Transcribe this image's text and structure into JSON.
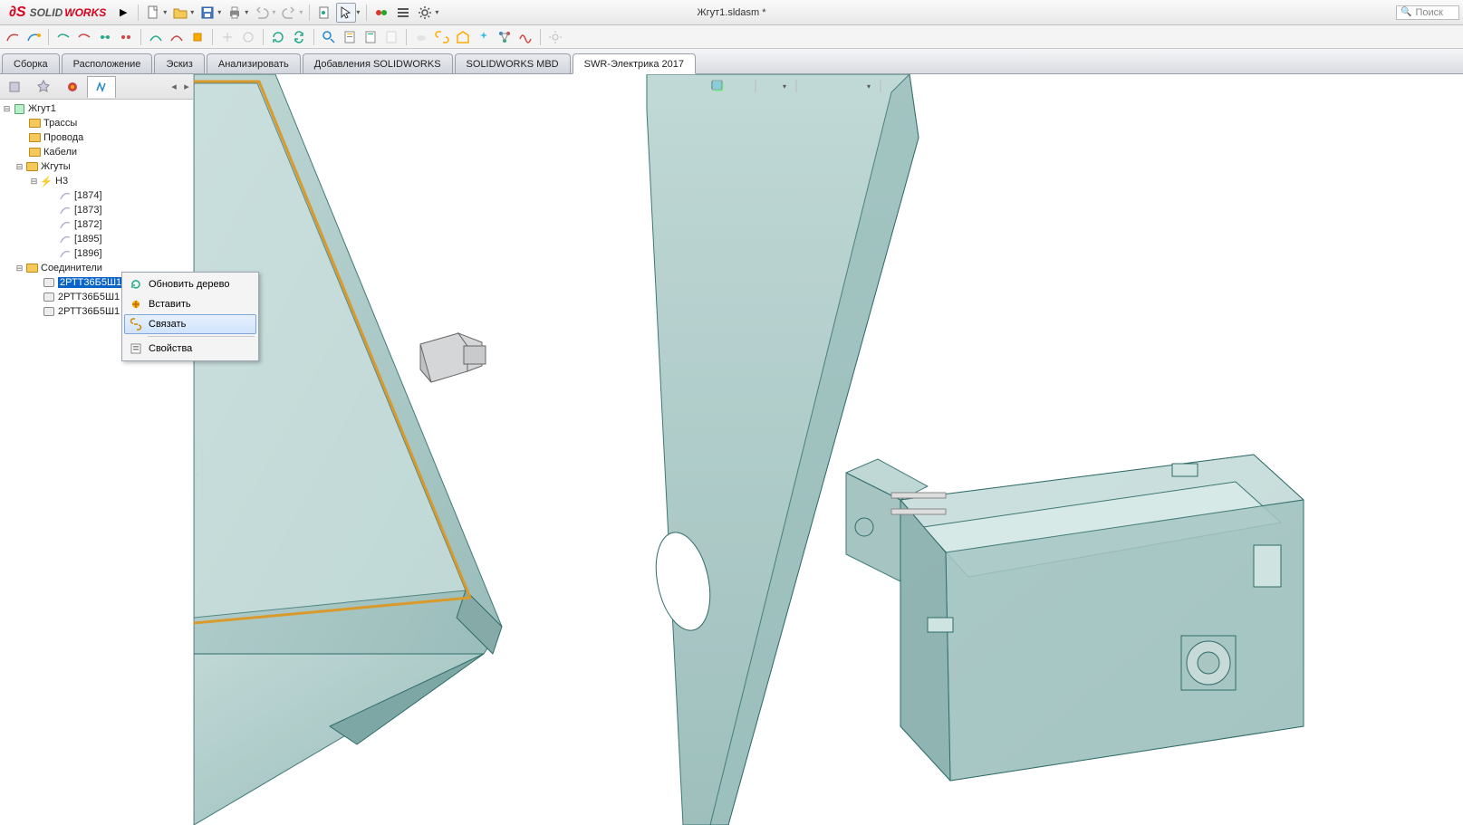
{
  "app": {
    "logo_solid": "SOLID",
    "logo_works": "WORKS",
    "doc_title": "Жгут1.sldasm *",
    "search_placeholder": "Поиск"
  },
  "tabs": {
    "items": [
      "Сборка",
      "Расположение",
      "Эскиз",
      "Анализировать",
      "Добавления SOLIDWORKS",
      "SOLIDWORKS MBD",
      "SWR-Электрика 2017"
    ],
    "active_index": 6
  },
  "tree": {
    "root": "Жгут1",
    "folders": {
      "traces": "Трассы",
      "wires": "Провода",
      "cables": "Кабели",
      "harnesses": "Жгуты",
      "connectors": "Соединители"
    },
    "harness_node": "Н3",
    "harness_children": [
      "[1874]",
      "[1873]",
      "[1872]",
      "[1895]",
      "[1896]"
    ],
    "connectors": [
      "2РТТ36Б5Ш15",
      "2РТТ36Б5Ш1",
      "2РТТ36Б5Ш1"
    ]
  },
  "context_menu": {
    "items": [
      "Обновить дерево",
      "Вставить",
      "Связать",
      "Свойства"
    ],
    "highlight_index": 2
  }
}
